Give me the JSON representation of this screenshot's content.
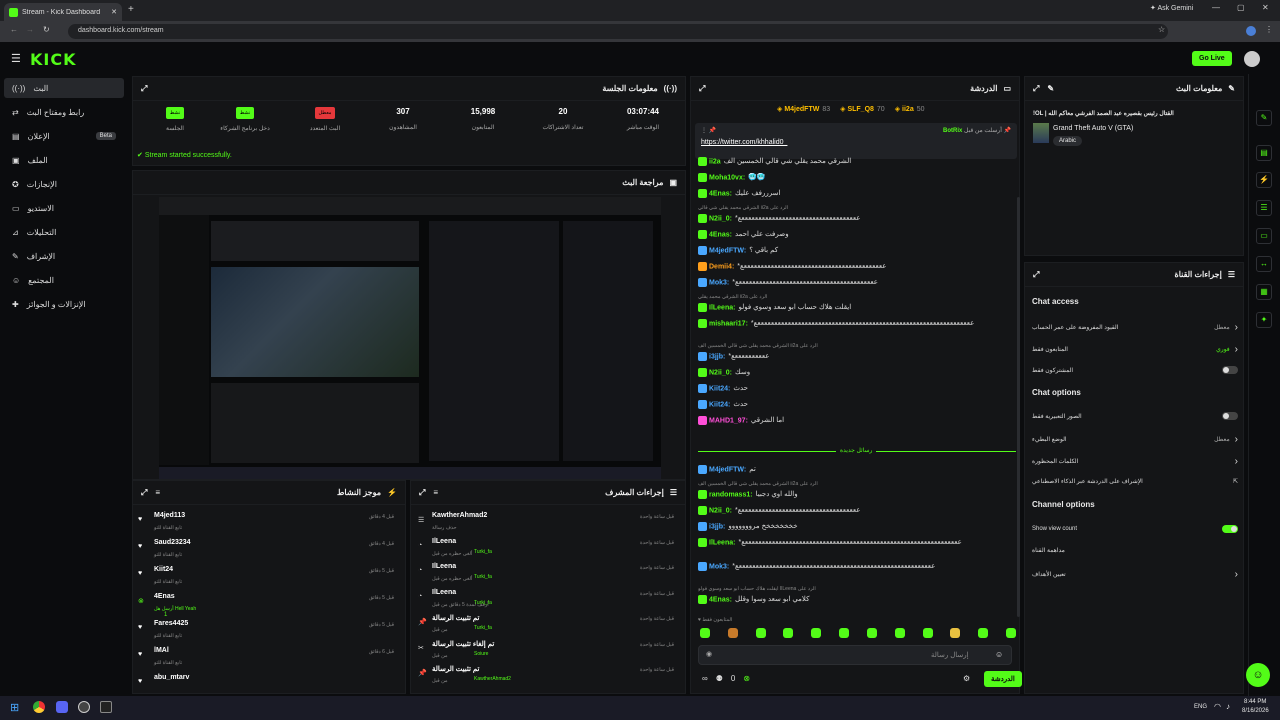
{
  "browser": {
    "tab_title": "Stream - Kick Dashboard",
    "url": "dashboard.kick.com/stream",
    "ask_gemini": "Ask Gemini"
  },
  "header": {
    "logo": "KICK",
    "go_live": "Go Live"
  },
  "sidebar": {
    "items": [
      {
        "label": "البث"
      },
      {
        "label": "رابط ومفتاح البث"
      },
      {
        "label": "الإعلان",
        "badge": "Beta"
      },
      {
        "label": "الملف"
      },
      {
        "label": "الإنجازات"
      },
      {
        "label": "الاستديو"
      },
      {
        "label": "التحليلات"
      },
      {
        "label": "الإشراف"
      },
      {
        "label": "المجتمع"
      },
      {
        "label": "الإنزالات و الجوائز"
      }
    ]
  },
  "session": {
    "title": "معلومات الجلسة",
    "stats": [
      {
        "value": "نشط",
        "label": "الجلسة",
        "color": "#53fc18"
      },
      {
        "value": "نشط",
        "label": "دخل برنامج الشركاء",
        "color": "#53fc18"
      },
      {
        "value": "معطل",
        "label": "البث المتعدد",
        "color": "#e5383b"
      },
      {
        "value": "307",
        "label": "المشاهدون"
      },
      {
        "value": "15,998",
        "label": "المتابعون"
      },
      {
        "value": "20",
        "label": "تعداد الاشتراكات"
      },
      {
        "value": "03:07:44",
        "label": "الوقت مباشر"
      }
    ],
    "notice": "Stream started successfully."
  },
  "preview": {
    "title": "مراجعة البث"
  },
  "activity": {
    "title": "موجز النشاط",
    "items": [
      {
        "name": "M4jed113",
        "desc": "تابع القناة للتو",
        "time": "قبل 4 دقائق"
      },
      {
        "name": "Saud23234",
        "desc": "تابع القناة للتو",
        "time": "قبل 4 دقائق"
      },
      {
        "name": "Kiit24",
        "desc": "تابع القناة للتو",
        "time": "قبل 5 دقائق"
      },
      {
        "name": "4Enas",
        "desc": "أرسل هل Hell Yeah",
        "time": "قبل 5 دقائق",
        "extra": "1"
      },
      {
        "name": "Fares4425",
        "desc": "تابع القناة للتو",
        "time": "قبل 5 دقائق"
      },
      {
        "name": "lMAl",
        "desc": "تابع القناة للتو",
        "time": "قبل 6 دقائق"
      },
      {
        "name": "abu_mtarv",
        "desc": "",
        "time": ""
      }
    ]
  },
  "modactions": {
    "title": "إجراءات المشرف",
    "items": [
      {
        "name": "KawtherAhmad2",
        "desc": "حذف رسالة",
        "target": "",
        "time": "قبل ساعة واحدة"
      },
      {
        "name": "IlLeena",
        "desc": "ألغى حظره من قبل",
        "target": "Turki_fa",
        "time": "قبل ساعة واحدة"
      },
      {
        "name": "IlLeena",
        "desc": "ألغى حظره من قبل",
        "target": "Turki_fa",
        "time": "قبل ساعة واحدة"
      },
      {
        "name": "IlLeena",
        "desc": "أرقف لمدة 5 دقائق من قبل",
        "target": "Turki_fa",
        "time": "قبل ساعة واحدة"
      },
      {
        "name": "تم تثبيت الرسالة",
        "desc": "من قبل",
        "target": "Turki_fa",
        "time": "قبل ساعة واحدة"
      },
      {
        "name": "تم إلغاء تثبيت الرسالة",
        "desc": "من قبل",
        "target": "Soiure",
        "time": "قبل ساعة واحدة"
      },
      {
        "name": "تم تثبيت الرسالة",
        "desc": "من قبل",
        "target": "KawtherAhmad2",
        "time": "قبل ساعة واحدة"
      }
    ]
  },
  "chat": {
    "title": "الدردشة",
    "top_gifters": [
      {
        "name": "M4jedFTW",
        "count": "83"
      },
      {
        "name": "SLF_Q8",
        "count": "70"
      },
      {
        "name": "ii2a",
        "count": "50"
      }
    ],
    "pinned": {
      "by": "BotRix",
      "label": "أرسلت من قبل",
      "link": "https://twitter.com/khhalid0_"
    },
    "messages": [
      {
        "user": "ii2a",
        "text": "الشرقي محمد يقلي شي قالي الخمسين الف",
        "color": "#53fc18"
      },
      {
        "user": "Moha10vx:",
        "text": "🥶🥶",
        "color": "#53fc18"
      },
      {
        "user": "4Enas:",
        "text": "اسرررفف عليك",
        "color": "#53fc18"
      },
      {
        "user": "N2ii_0:",
        "text": "*عععععععععععععععععععععععععععععععععععع",
        "color": "#53fc18",
        "reply": "الشرقي محمد يقلي شي قالي ii2a الرد على"
      },
      {
        "user": "4Enas:",
        "text": "وصرفت علي احمد",
        "color": "#53fc18"
      },
      {
        "user": "M4jedFTW:",
        "text": "كم باقي ؟",
        "color": "#4aa8ff"
      },
      {
        "user": "Demii4:",
        "text": "*ععععععععععععععععععععععععععععععععععععععععععع",
        "color": "#ff9f1c"
      },
      {
        "user": "Mok3:",
        "text": "*عععععععععععععععععععععععععععععععععععععععععع",
        "color": "#4aa8ff"
      },
      {
        "user": "IlLeena:",
        "text": "ايقلت هلاك حساب ابو سعد وسوي فولو",
        "color": "#53fc18",
        "reply": "الشرقي محمد يقلي ii2a الرد على"
      },
      {
        "user": "mishaari17:",
        "text": "*ععععععععععععععععععععععععععععععععععععععععععععععععععععععععععععععععع",
        "color": "#53fc18"
      },
      {
        "user": "i3jjb:",
        "text": "*ععععععععععع",
        "color": "#4aa8ff",
        "reply": "الشرقي محمد يقلي شي قالي الخمسين الف ii2a الرد على"
      },
      {
        "user": "N2ii_0:",
        "text": "وسك",
        "color": "#53fc18"
      },
      {
        "user": "Kiit24:",
        "text": "حدث",
        "color": "#4aa8ff"
      },
      {
        "user": "Kiit24:",
        "text": "حدث",
        "color": "#4aa8ff"
      },
      {
        "user": "MAHD1_97:",
        "text": "اما الشرقي",
        "color": "#ff4fd8"
      },
      {
        "user": "M4jedFTW:",
        "text": "تم",
        "color": "#4aa8ff"
      },
      {
        "user": "randomass1:",
        "text": "والله اوي دجبيا",
        "color": "#53fc18",
        "reply": "الشرقي محمد يقلي شي قالي الخمسين الف ii2a الرد على"
      },
      {
        "user": "N2ii_0:",
        "text": "*عععععععععععععععععععععععععععععععععععع",
        "color": "#53fc18"
      },
      {
        "user": "i3jjb:",
        "text": "خخخخخخخخ مرووووووو",
        "color": "#4aa8ff"
      },
      {
        "user": "IlLeena:",
        "text": "*ععععععععععععععععععععععععععععععععععععععععععععععععععععععععععععععععع",
        "color": "#53fc18"
      },
      {
        "user": "Mok3:",
        "text": "*ععععععععععععععععععععععععععععععععععععععععععععععععععععععععععع",
        "color": "#4aa8ff"
      },
      {
        "user": "4Enas:",
        "text": "كلامي ابو سعد وسوا وقلل",
        "color": "#53fc18",
        "reply": "ايقلت هلاك حساب ابو سعد وسوي فولو IlLeena الرد على"
      }
    ],
    "new_messages": "رسائل جديدة",
    "followers_only": "المتابعون فقط",
    "input_placeholder": "إرسال رسالة",
    "send_label": "الدردشة",
    "viewer_count": "0"
  },
  "stream_info": {
    "title": "معلومات البث",
    "stream_title": "!OL | القتال رئيس بقصيره عبد الصمد الفرشي معاكم الله",
    "category": "Grand Theft Auto V (GTA)",
    "language": "Arabic"
  },
  "channel_actions": {
    "title": "إجراءات القناة",
    "chat_access": "Chat access",
    "access_rows": [
      {
        "label": "القيود المفروضة على عمر الحساب",
        "value": "معطل",
        "type": "chevron"
      },
      {
        "label": "المتابعون فقط",
        "value": "فوري",
        "type": "chevron"
      },
      {
        "label": "المشتركون فقط",
        "value": "",
        "type": "toggle-off"
      }
    ],
    "chat_options": "Chat options",
    "option_rows": [
      {
        "label": "الصور التعبيرية فقط",
        "value": "",
        "type": "toggle-off"
      },
      {
        "label": "الوضع البطيء",
        "value": "معطل",
        "type": "chevron"
      },
      {
        "label": "الكلمات المحظورة",
        "value": "",
        "type": "chevron"
      },
      {
        "label": "الإشراف على الدردشة عبر الذكاء الاصطناعي",
        "value": "",
        "type": "external"
      }
    ],
    "channel_options": "Channel options",
    "channel_rows": [
      {
        "label": "Show view count",
        "value": "",
        "type": "toggle-on"
      },
      {
        "label": "مداهمة القناة",
        "value": "",
        "type": "none"
      },
      {
        "label": "تعيين الأهداف",
        "value": "",
        "type": "chevron"
      }
    ]
  },
  "taskbar": {
    "lang": "ENG",
    "time": "8:44 PM",
    "date": "8/16/2026"
  },
  "colors": {
    "accent": "#53fc18",
    "danger": "#e5383b",
    "panel": "#141517"
  }
}
